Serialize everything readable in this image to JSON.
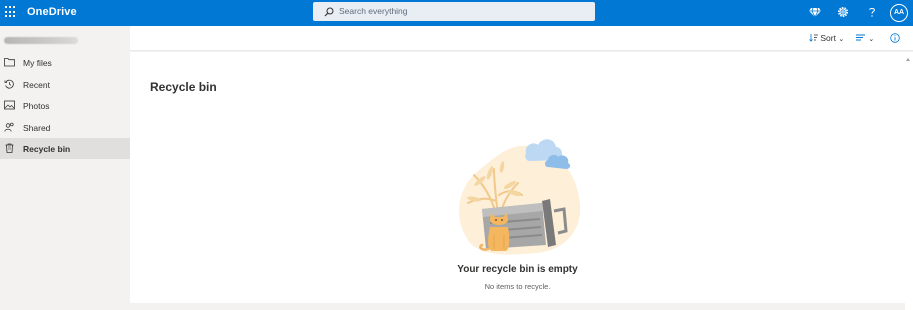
{
  "app": {
    "brand": "OneDrive"
  },
  "search": {
    "placeholder": "Search everything"
  },
  "topbar": {
    "avatar_initials": "AA",
    "icons": [
      "diamond-icon",
      "gear-icon",
      "help-icon"
    ]
  },
  "sidebar": {
    "items": [
      {
        "label": "My files",
        "icon": "folder-icon"
      },
      {
        "label": "Recent",
        "icon": "clock-icon"
      },
      {
        "label": "Photos",
        "icon": "photo-icon"
      },
      {
        "label": "Shared",
        "icon": "people-icon"
      },
      {
        "label": "Recycle bin",
        "icon": "trash-icon",
        "active": true
      }
    ]
  },
  "commandbar": {
    "sort_label": "Sort"
  },
  "main": {
    "title": "Recycle bin",
    "empty_title": "Your recycle bin is empty",
    "empty_subtitle": "No items to recycle."
  },
  "colors": {
    "brand": "#0078d4",
    "sidebar_bg": "#f3f2f1",
    "active_item": "#e1dfdd"
  }
}
